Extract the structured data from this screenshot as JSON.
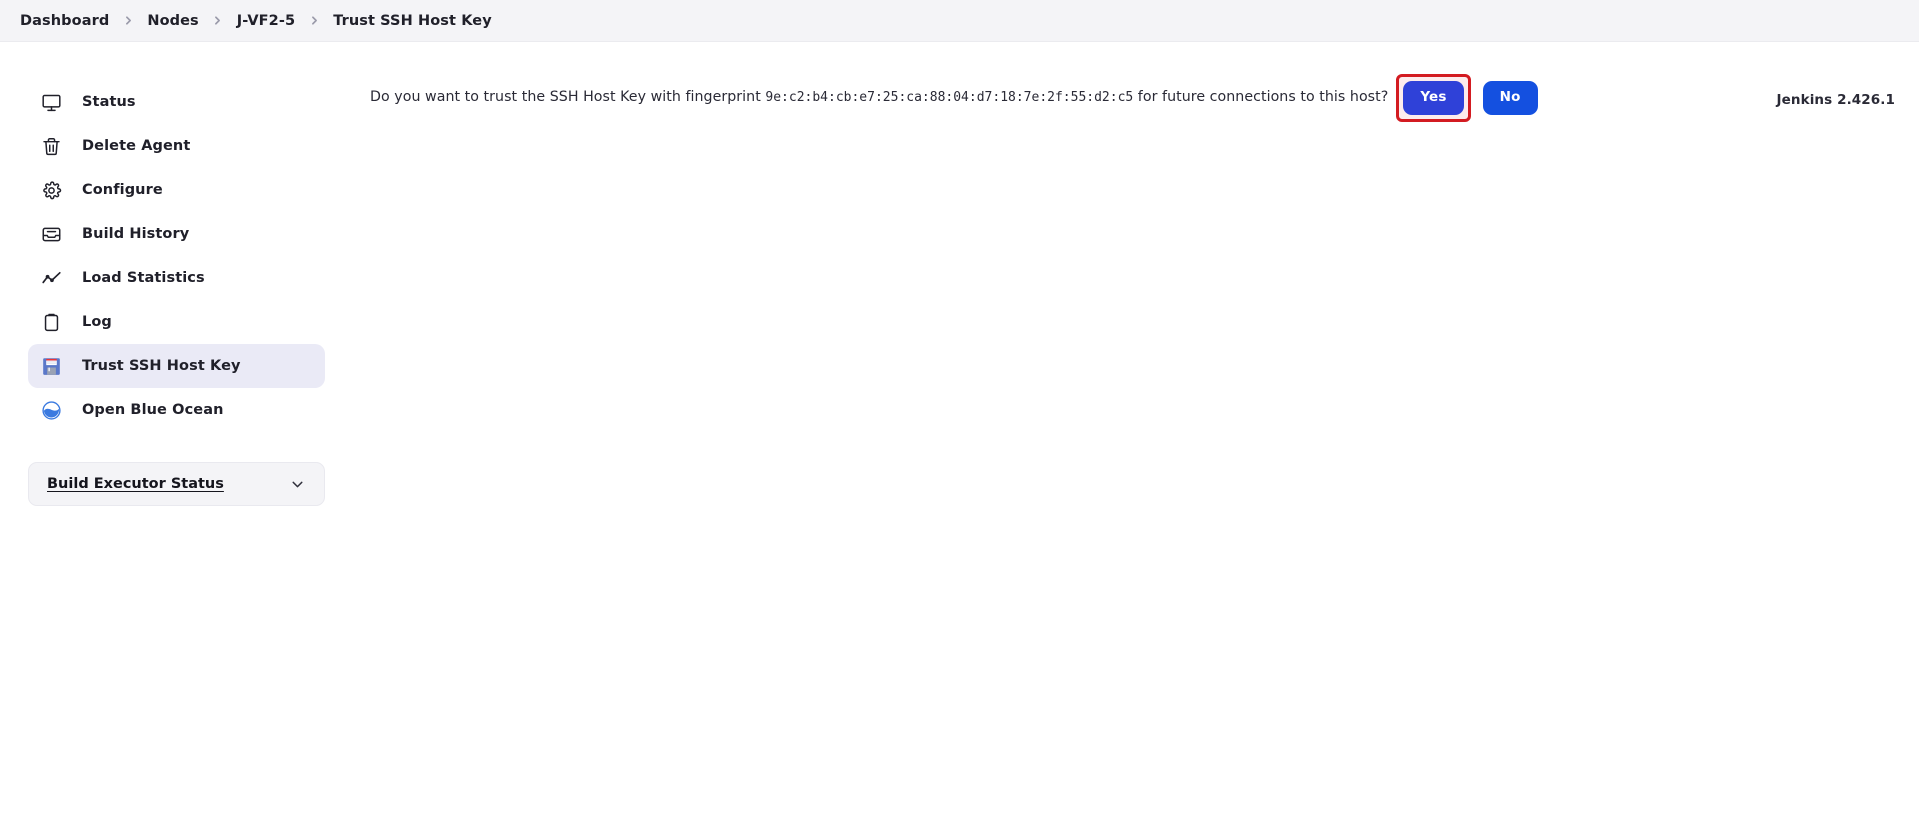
{
  "breadcrumb": {
    "items": [
      {
        "label": "Dashboard",
        "current": false
      },
      {
        "label": "Nodes",
        "current": false
      },
      {
        "label": "J-VF2-5",
        "current": false
      },
      {
        "label": "Trust SSH Host Key",
        "current": true
      }
    ],
    "separator_icon": "chevron-right-icon"
  },
  "sidebar": {
    "items": [
      {
        "label": "Status",
        "icon": "monitor-icon",
        "active": false
      },
      {
        "label": "Delete Agent",
        "icon": "trash-icon",
        "active": false
      },
      {
        "label": "Configure",
        "icon": "gear-icon",
        "active": false
      },
      {
        "label": "Build History",
        "icon": "inbox-icon",
        "active": false
      },
      {
        "label": "Load Statistics",
        "icon": "line-chart-icon",
        "active": false
      },
      {
        "label": "Log",
        "icon": "clipboard-icon",
        "active": false
      },
      {
        "label": "Trust SSH Host Key",
        "icon": "floppy-disk-icon",
        "active": true
      },
      {
        "label": "Open Blue Ocean",
        "icon": "blue-ocean-icon",
        "active": false
      }
    ],
    "widget": {
      "title": "Build Executor Status",
      "toggle_icon": "chevron-down-icon"
    }
  },
  "main": {
    "prompt_prefix": "Do you want to trust the SSH Host Key with fingerprint ",
    "fingerprint": "9e:c2:b4:cb:e7:25:ca:88:04:d7:18:7e:2f:55:d2:c5",
    "prompt_suffix": " for future connections to this host?",
    "yes_label": "Yes",
    "no_label": "No"
  },
  "footer": {
    "version": "Jenkins 2.426.1"
  },
  "colors": {
    "breadcrumb_bg": "#f4f4f7",
    "active_item_bg": "#eaeaf6",
    "button_yes_bg": "#2f41d8",
    "button_no_bg": "#1450e0",
    "highlight_ring": "#d31b21",
    "text": "#20202a"
  }
}
